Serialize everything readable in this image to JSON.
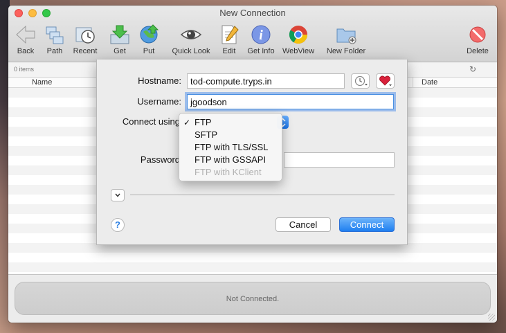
{
  "window": {
    "title": "New Connection"
  },
  "toolbar": [
    {
      "id": "back",
      "label": "Back",
      "icon": "back-arrow-icon"
    },
    {
      "id": "path",
      "label": "Path",
      "icon": "path-icon"
    },
    {
      "id": "recent",
      "label": "Recent",
      "icon": "recent-clock-icon"
    },
    {
      "id": "get",
      "label": "Get",
      "icon": "download-icon"
    },
    {
      "id": "put",
      "label": "Put",
      "icon": "upload-globe-icon"
    },
    {
      "id": "quicklook",
      "label": "Quick Look",
      "icon": "eye-icon"
    },
    {
      "id": "edit",
      "label": "Edit",
      "icon": "edit-pencil-icon"
    },
    {
      "id": "getinfo",
      "label": "Get Info",
      "icon": "info-icon"
    },
    {
      "id": "webview",
      "label": "WebView",
      "icon": "chrome-icon"
    },
    {
      "id": "newfolder",
      "label": "New Folder",
      "icon": "folder-add-icon"
    },
    {
      "id": "delete",
      "label": "Delete",
      "icon": "delete-icon"
    }
  ],
  "browser": {
    "item_count": "0 items",
    "columns": {
      "name": "Name",
      "date": "Date"
    }
  },
  "dialog": {
    "hostname_label": "Hostname:",
    "hostname_value": "tod-compute.tryps.in",
    "username_label": "Username:",
    "username_value": "jgoodson",
    "connect_using_label": "Connect using",
    "password_label": "Password",
    "protocol_options": [
      {
        "label": "FTP",
        "selected": true,
        "enabled": true
      },
      {
        "label": "SFTP",
        "selected": false,
        "enabled": true
      },
      {
        "label": "FTP with TLS/SSL",
        "selected": false,
        "enabled": true
      },
      {
        "label": "FTP with GSSAPI",
        "selected": false,
        "enabled": true
      },
      {
        "label": "FTP with KClient",
        "selected": false,
        "enabled": false
      }
    ],
    "cancel_label": "Cancel",
    "connect_label": "Connect",
    "help_label": "?"
  },
  "status": {
    "text": "Not Connected."
  },
  "colors": {
    "accent": "#1f7ff0",
    "close": "#fc615d",
    "minimize": "#fdbc40",
    "maximize": "#34c84a",
    "heart": "#d9213b"
  }
}
